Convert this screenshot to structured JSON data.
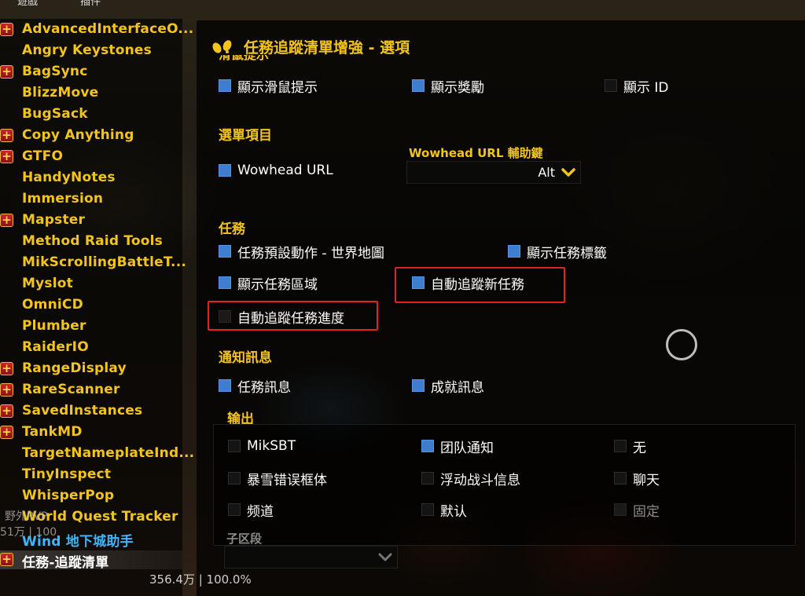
{
  "top_tabs": [
    "遊戲",
    "插件"
  ],
  "sidebar": {
    "items": [
      {
        "label": "AdvancedInterfaceO...",
        "expandable": true
      },
      {
        "label": "Angry Keystones",
        "expandable": false
      },
      {
        "label": "BagSync",
        "expandable": true
      },
      {
        "label": "BlizzMove",
        "expandable": false
      },
      {
        "label": "BugSack",
        "expandable": false
      },
      {
        "label": "Copy Anything",
        "expandable": true
      },
      {
        "label": "GTFO",
        "expandable": true
      },
      {
        "label": "HandyNotes",
        "expandable": false
      },
      {
        "label": "Immersion",
        "expandable": false
      },
      {
        "label": "Mapster",
        "expandable": true
      },
      {
        "label": "Method Raid Tools",
        "expandable": false
      },
      {
        "label": "MikScrollingBattleT...",
        "expandable": false
      },
      {
        "label": "Myslot",
        "expandable": false
      },
      {
        "label": "OmniCD",
        "expandable": false
      },
      {
        "label": "Plumber",
        "expandable": false
      },
      {
        "label": "RaiderIO",
        "expandable": false
      },
      {
        "label": "RangeDisplay",
        "expandable": true
      },
      {
        "label": "RareScanner",
        "expandable": true
      },
      {
        "label": "SavedInstances",
        "expandable": true
      },
      {
        "label": "TankMD",
        "expandable": true
      },
      {
        "label": "TargetNameplateInd...",
        "expandable": false
      },
      {
        "label": "TinyInspect",
        "expandable": false
      },
      {
        "label": "WhisperPop",
        "expandable": false
      },
      {
        "label": "World Quest Tracker",
        "expandable": false
      },
      {
        "label": "Wind 地下城助手",
        "expandable": false,
        "color": "blue"
      },
      {
        "label": "任務-追蹤清單",
        "expandable": true,
        "selected": true
      }
    ]
  },
  "background_text": {
    "left_label": "野外PVP",
    "left_stats": "51万 | 100",
    "footer_stats": "356.4万 | 100.0%"
  },
  "panel": {
    "title": "任務追蹤清單增強 - 選項",
    "cut_section_label": "滑鼠提示",
    "tooltip_options": [
      {
        "label": "顯示滑鼠提示",
        "checked": true
      },
      {
        "label": "顯示獎勵",
        "checked": true
      },
      {
        "label": "顯示 ID",
        "checked": false
      }
    ],
    "menu_section": "選單項目",
    "wowhead_option": {
      "label": "Wowhead URL",
      "checked": true
    },
    "wowhead_dropdown": {
      "label": "Wowhead URL 輔助鍵",
      "value": "Alt"
    },
    "quest_section": "任務",
    "quest_options": [
      {
        "label": "任務預設動作 - 世界地圖",
        "checked": true
      },
      {
        "label": "顯示任務標籤",
        "checked": true
      },
      {
        "label": "顯示任務區域",
        "checked": true
      },
      {
        "label": "自動追蹤新任務",
        "checked": true
      },
      {
        "label": "自動追蹤任務進度",
        "checked": false
      }
    ],
    "notify_section": "通知訊息",
    "notify_options": [
      {
        "label": "任務訊息",
        "checked": true
      },
      {
        "label": "成就訊息",
        "checked": true
      }
    ],
    "output_section": "输出",
    "output_options": [
      {
        "label": "MikSBT",
        "checked": false
      },
      {
        "label": "团队通知",
        "checked": true
      },
      {
        "label": "无",
        "checked": false
      },
      {
        "label": "暴雪错误框体",
        "checked": false
      },
      {
        "label": "浮动战斗信息",
        "checked": false
      },
      {
        "label": "聊天",
        "checked": false
      },
      {
        "label": "频道",
        "checked": false
      },
      {
        "label": "默认",
        "checked": false
      },
      {
        "label": "固定",
        "checked": false,
        "disabled": true
      }
    ],
    "subchannel": {
      "label": "子区段",
      "value": ""
    }
  },
  "colors": {
    "accent_gold": "#f3c41c",
    "checkbox_blue": "#3f7dd1",
    "highlight_red": "#e32222",
    "link_blue": "#3db7ff"
  }
}
